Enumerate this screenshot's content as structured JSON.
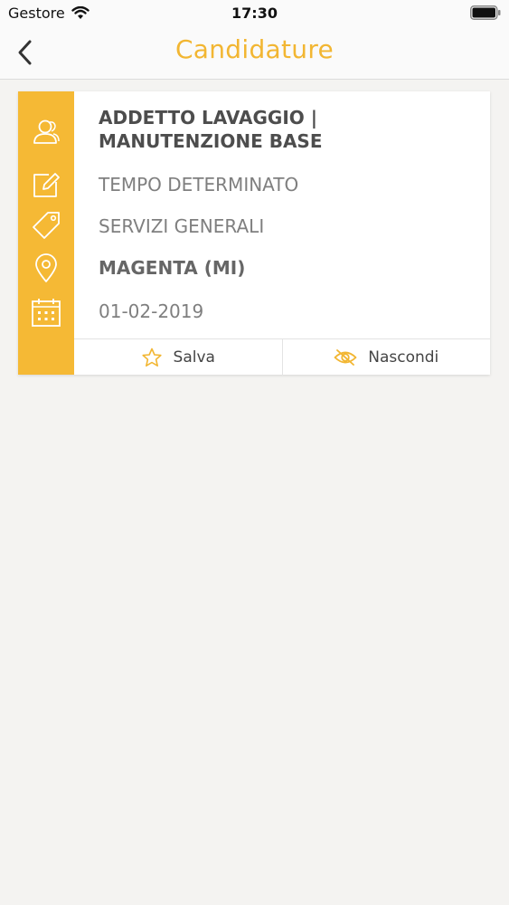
{
  "status_bar": {
    "carrier": "Gestore",
    "time": "17:30"
  },
  "nav": {
    "title": "Candidature",
    "back_icon": "chevron-left-icon"
  },
  "colors": {
    "accent": "#f5b935",
    "title_accent": "#f2b632"
  },
  "job": {
    "title": "ADDETTO LAVAGGIO | MANUTENZIONE BASE",
    "contract": "TEMPO DETERMINATO",
    "category": "SERVIZI GENERALI",
    "location": "MAGENTA (MI)",
    "date": "01-02-2019",
    "icons": [
      "users-icon",
      "edit-icon",
      "tag-icon",
      "map-pin-icon",
      "calendar-icon"
    ]
  },
  "actions": {
    "save_label": "Salva",
    "hide_label": "Nascondi"
  }
}
